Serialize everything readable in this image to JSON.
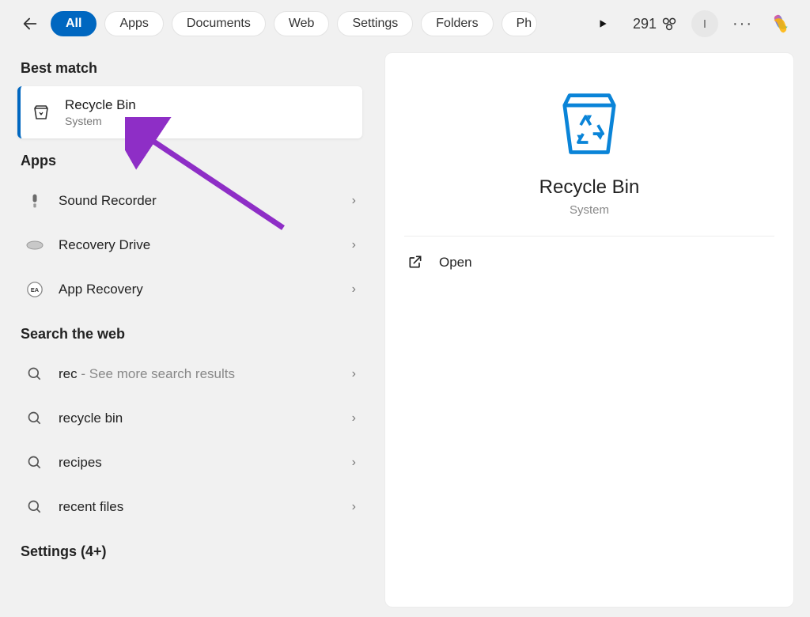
{
  "topbar": {
    "tabs": [
      "All",
      "Apps",
      "Documents",
      "Web",
      "Settings",
      "Folders",
      "Ph"
    ],
    "active_index": 0,
    "points": "291",
    "avatar_initial": "I"
  },
  "left": {
    "best_match_label": "Best match",
    "best_match": {
      "title": "Recycle Bin",
      "subtitle": "System"
    },
    "apps_label": "Apps",
    "apps": [
      {
        "name": "Sound Recorder"
      },
      {
        "name": "Recovery Drive"
      },
      {
        "name": "App Recovery"
      }
    ],
    "web_label": "Search the web",
    "web": [
      {
        "term": "rec",
        "suffix": " - See more search results"
      },
      {
        "term": "recycle bin",
        "suffix": ""
      },
      {
        "term": "recipes",
        "suffix": ""
      },
      {
        "term": "recent files",
        "suffix": ""
      }
    ],
    "settings_label": "Settings (4+)"
  },
  "preview": {
    "title": "Recycle Bin",
    "subtitle": "System",
    "action_open": "Open"
  }
}
